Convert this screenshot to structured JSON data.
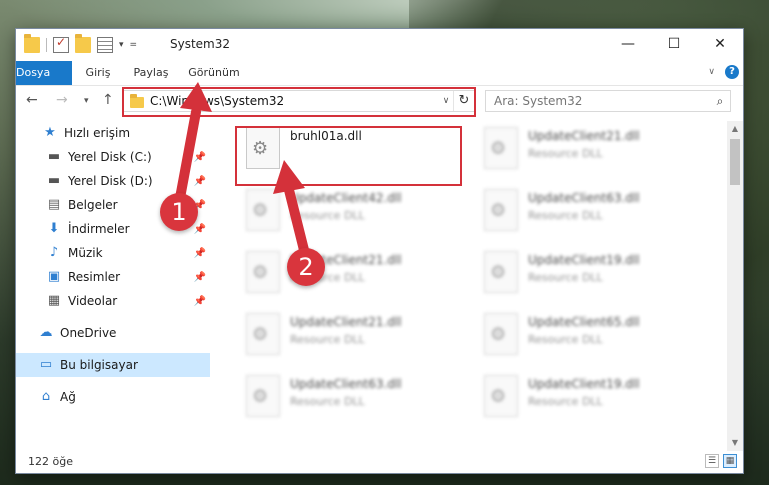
{
  "window": {
    "title": "System32",
    "controls": {
      "minimize": "—",
      "maximize": "☐",
      "close": "✕"
    }
  },
  "ribbon": {
    "tabs": [
      "Dosya",
      "Giriş",
      "Paylaş",
      "Görünüm"
    ]
  },
  "navigation": {
    "address": "C:\\Windows\\System32",
    "search_placeholder": "Ara: System32"
  },
  "sidebar": {
    "items": [
      {
        "label": "Hızlı erişim",
        "icon": "star-icon"
      },
      {
        "label": "Yerel Disk (C:)",
        "icon": "disk-icon",
        "pinned": true
      },
      {
        "label": "Yerel Disk (D:)",
        "icon": "disk-icon",
        "pinned": true
      },
      {
        "label": "Belgeler",
        "icon": "documents-icon",
        "pinned": true
      },
      {
        "label": "İndirmeler",
        "icon": "download-icon",
        "pinned": true
      },
      {
        "label": "Müzik",
        "icon": "music-icon",
        "pinned": true
      },
      {
        "label": "Resimler",
        "icon": "pictures-icon",
        "pinned": true
      },
      {
        "label": "Videolar",
        "icon": "videos-icon",
        "pinned": true
      },
      {
        "label": "OneDrive",
        "icon": "cloud-icon"
      },
      {
        "label": "Bu bilgisayar",
        "icon": "computer-icon",
        "selected": true
      },
      {
        "label": "Ağ",
        "icon": "network-icon"
      }
    ]
  },
  "files": [
    {
      "name": "bruhl01a.dll",
      "type": "",
      "highlighted": true
    },
    {
      "name": "UpdateClient21.dll",
      "type": "Resource DLL"
    },
    {
      "name": "UpdateClient42.dll",
      "type": "Resource DLL"
    },
    {
      "name": "UpdateClient63.dll",
      "type": "Resource DLL"
    },
    {
      "name": "UpdateClient21.dll",
      "type": "Resource DLL"
    },
    {
      "name": "UpdateClient19.dll",
      "type": "Resource DLL"
    },
    {
      "name": "UpdateClient21.dll",
      "type": "Resource DLL"
    },
    {
      "name": "UpdateClient65.dll",
      "type": "Resource DLL"
    },
    {
      "name": "UpdateClient63.dll",
      "type": "Resource DLL"
    },
    {
      "name": "UpdateClient19.dll",
      "type": "Resource DLL"
    }
  ],
  "status": {
    "count": "122 öğe"
  },
  "annotations": {
    "badge_1": "1",
    "badge_2": "2",
    "color": "#d4313a"
  }
}
